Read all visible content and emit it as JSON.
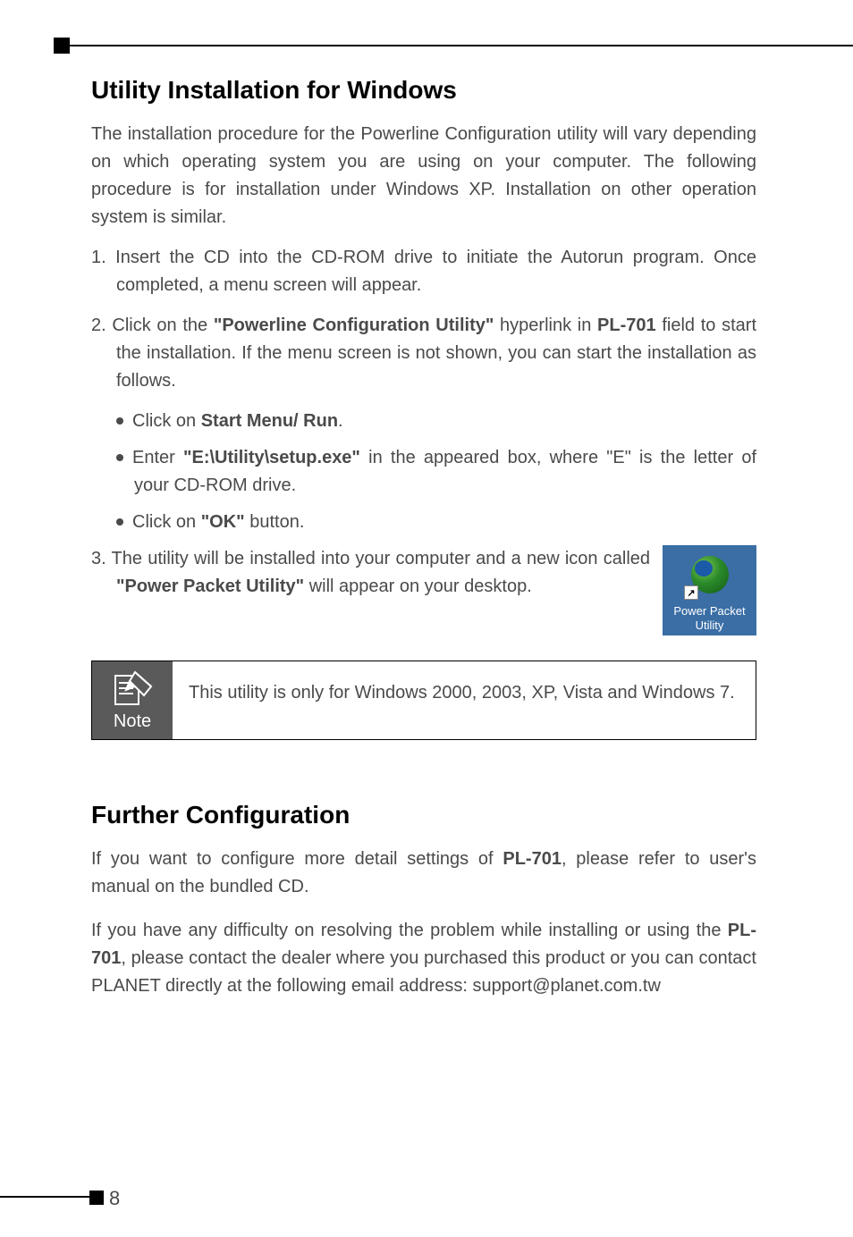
{
  "section1": {
    "heading": "Utility Installation for Windows",
    "intro": "The installation procedure for the Powerline Configuration utility will vary depending on which operating system you are using on your computer. The following procedure is for installation under Windows XP. Installation on other operation system is similar.",
    "step1_prefix": "1. ",
    "step1": "Insert the CD into the CD-ROM drive to initiate the Autorun program. Once completed, a menu screen will appear.",
    "step2_prefix": "2. ",
    "step2_a": "Click on the ",
    "step2_b": "\"Powerline Configuration Utility\"",
    "step2_c": " hyperlink in ",
    "step2_d": "PL-701",
    "step2_e": " field to start the installation. If the menu screen is not shown, you can start the installation as follows.",
    "bullet1_a": "Click on ",
    "bullet1_b": "Start Menu/ Run",
    "bullet1_c": ".",
    "bullet2_a": "Enter ",
    "bullet2_b": "\"E:\\Utility\\setup.exe\"",
    "bullet2_c": " in the appeared box, where \"E\" is the letter of your CD-ROM drive.",
    "bullet3_a": "Click on ",
    "bullet3_b": "\"OK\"",
    "bullet3_c": " button.",
    "step3_prefix": "3. ",
    "step3_a": "The utility will be installed into your computer and a new icon called ",
    "step3_b": "\"Power Packet Utility\"",
    "step3_c": " will appear on your desktop.",
    "icon_label": "Power Packet Utility",
    "shortcut_glyph": "↗"
  },
  "note": {
    "label": "Note",
    "text": "This utility is only for Windows 2000, 2003, XP, Vista and Windows 7."
  },
  "section2": {
    "heading": "Further Configuration",
    "para1_a": "If you want to configure more detail settings of ",
    "para1_b": "PL-701",
    "para1_c": ", please refer to user's manual on the bundled CD.",
    "para2_a": "If you have any difficulty on resolving the problem while installing or using the ",
    "para2_b": "PL-701",
    "para2_c": ", please contact the dealer where you purchased this product or you can contact PLANET directly at the following email address: support@planet.com.tw"
  },
  "page_number": "8"
}
